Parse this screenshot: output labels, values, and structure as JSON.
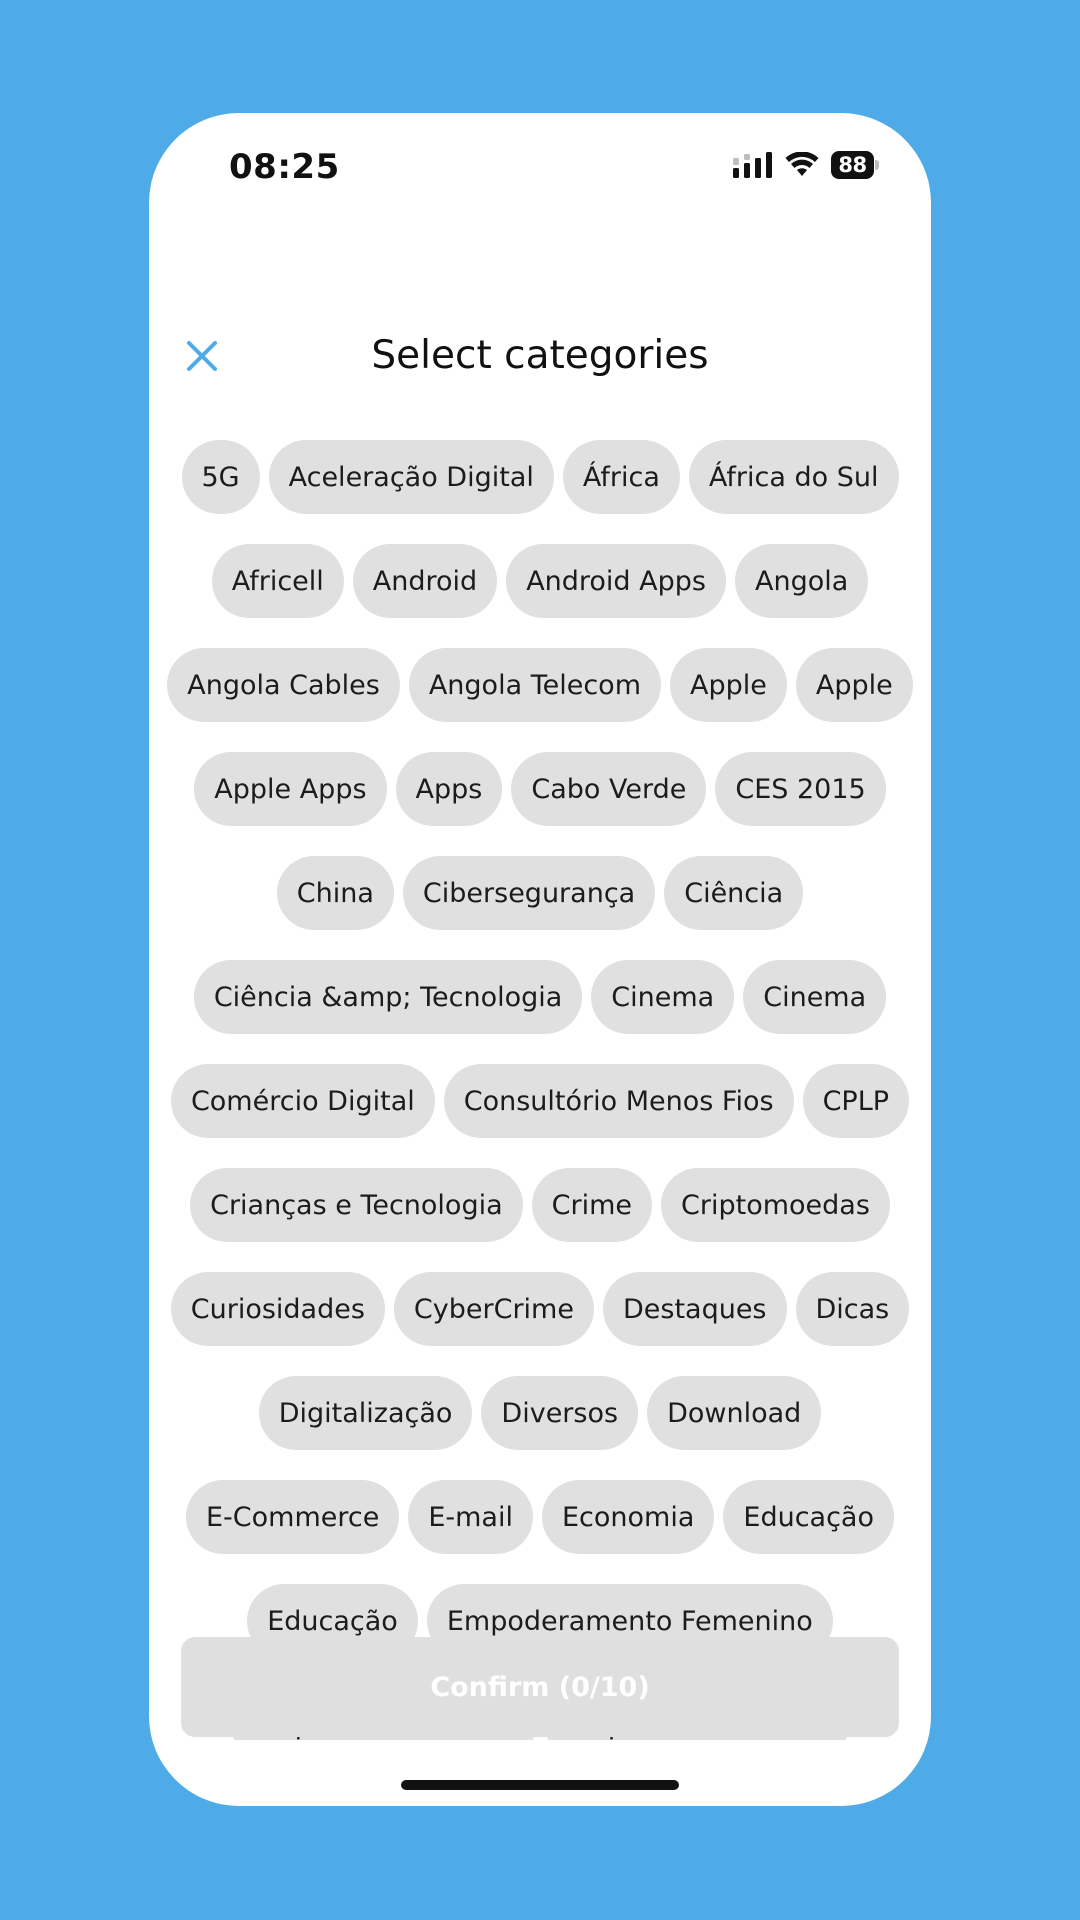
{
  "status_bar": {
    "time": "08:25",
    "battery_level": "88",
    "icons": [
      "signal-icon",
      "wifi-icon",
      "battery-icon"
    ]
  },
  "header": {
    "title": "Select categories",
    "close_icon": "close-icon"
  },
  "categories": {
    "rows": [
      [
        "5G",
        "Aceleração Digital",
        "África",
        "África do Sul"
      ],
      [
        "Africell",
        "Android",
        "Android Apps",
        "Angola"
      ],
      [
        "Angola Cables",
        "Angola Telecom",
        "Apple",
        "Apple"
      ],
      [
        "Apple Apps",
        "Apps",
        "Cabo Verde",
        "CES 2015"
      ],
      [
        "China",
        "Cibersegurança",
        "Ciência"
      ],
      [
        "Ciência &amp; Tecnologia",
        "Cinema",
        "Cinema"
      ],
      [
        "Comércio Digital",
        "Consultório Menos Fios",
        "CPLP"
      ],
      [
        "Crianças e Tecnologia",
        "Crime",
        "Criptomoedas"
      ],
      [
        "Curiosidades",
        "CyberCrime",
        "Destaques",
        "Dicas"
      ],
      [
        "Digitalização",
        "Diversos",
        "Download"
      ],
      [
        "E-Commerce",
        "E-mail",
        "Economia",
        "Educação"
      ],
      [
        "Educação",
        "Empoderamento Femenino"
      ],
      [
        "Empreendedorismo",
        "Empreendedorismo"
      ]
    ]
  },
  "confirm_button": {
    "label": "Confirm (0/10)"
  },
  "colors": {
    "background": "#4EABE8",
    "accent": "#4EABE8",
    "chip": "#e0e0e0",
    "button_disabled": "#dfdfdf"
  }
}
